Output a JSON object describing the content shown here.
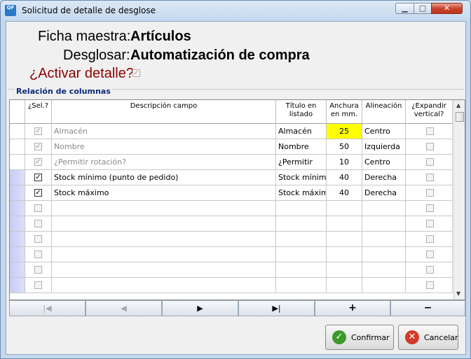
{
  "window": {
    "title": "Solicitud de detalle de desglose",
    "icon_text": "QF"
  },
  "form": {
    "ficha_label": "Ficha maestra:",
    "ficha_value": "Artículos",
    "desglosar_label": "Desglosar:",
    "desglosar_value": "Automatización de compra",
    "activar_label": "¿Activar detalle?"
  },
  "group": {
    "title": "Relación de columnas"
  },
  "grid": {
    "headers": {
      "sel": "¿Sel.?",
      "desc": "Descripción campo",
      "titulo": "Título en listado",
      "anchura": "Anchura en mm.",
      "alineacion": "Alineación",
      "expandir": "¿Expandir vertical?"
    },
    "rows": [
      {
        "sel": true,
        "disabled": true,
        "desc": "Almacén",
        "titulo": "Almacén",
        "anchura": "25",
        "alineacion": "Centro",
        "highlight": true
      },
      {
        "sel": true,
        "disabled": true,
        "desc": "Nombre",
        "titulo": "Nombre",
        "anchura": "50",
        "alineacion": "Izquierda"
      },
      {
        "sel": true,
        "disabled": true,
        "desc": "¿Permitir rotación?",
        "titulo": "¿Permitir",
        "anchura": "10",
        "alineacion": "Centro"
      },
      {
        "sel": true,
        "disabled": false,
        "desc": "Stock mínimo (punto de pedido)",
        "titulo": "Stock mínimo",
        "anchura": "40",
        "alineacion": "Derecha"
      },
      {
        "sel": true,
        "disabled": false,
        "desc": "Stock máximo",
        "titulo": "Stock máximo",
        "anchura": "40",
        "alineacion": "Derecha"
      },
      {
        "sel": false,
        "desc": "",
        "titulo": "",
        "anchura": "",
        "alineacion": ""
      },
      {
        "sel": false,
        "desc": "",
        "titulo": "",
        "anchura": "",
        "alineacion": ""
      },
      {
        "sel": false,
        "desc": "",
        "titulo": "",
        "anchura": "",
        "alineacion": ""
      },
      {
        "sel": false,
        "desc": "",
        "titulo": "",
        "anchura": "",
        "alineacion": ""
      },
      {
        "sel": false,
        "desc": "",
        "titulo": "",
        "anchura": "",
        "alineacion": ""
      },
      {
        "sel": false,
        "desc": "",
        "titulo": "",
        "anchura": "",
        "alineacion": ""
      }
    ]
  },
  "nav": {
    "first": "|◀",
    "prev": "◀",
    "next": "▶",
    "last": "▶|",
    "add": "+",
    "remove": "−"
  },
  "buttons": {
    "confirm": "Confirmar",
    "cancel": "Cancelar"
  },
  "colors": {
    "label_dark_red": "#8b0000",
    "highlight": "#ffff00",
    "group_title": "#0b2a7a"
  }
}
